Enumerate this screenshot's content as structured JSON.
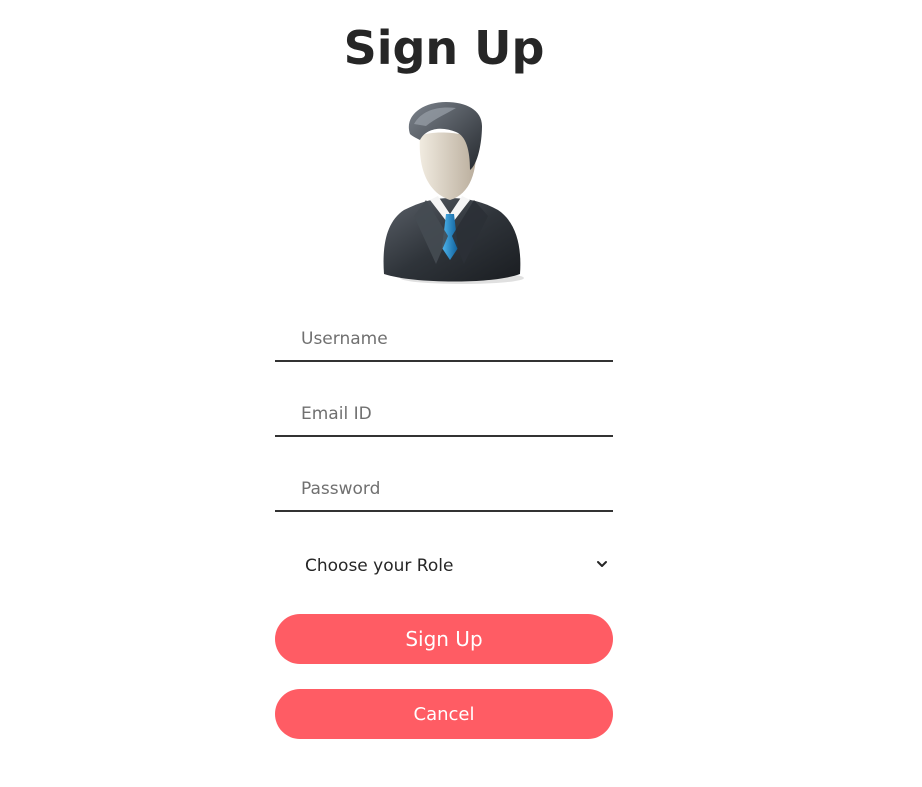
{
  "page": {
    "title": "Sign Up"
  },
  "avatar": {
    "icon": "businessman-avatar-icon"
  },
  "form": {
    "username_placeholder": "Username",
    "email_placeholder": "Email ID",
    "password_placeholder": "Password",
    "role_select": {
      "selected": "Choose your Role",
      "icon": "chevron-down-icon"
    },
    "signup_label": "Sign Up",
    "cancel_label": "Cancel"
  },
  "colors": {
    "accent": "#ff5c64",
    "text": "#262626",
    "underline": "#333333"
  }
}
